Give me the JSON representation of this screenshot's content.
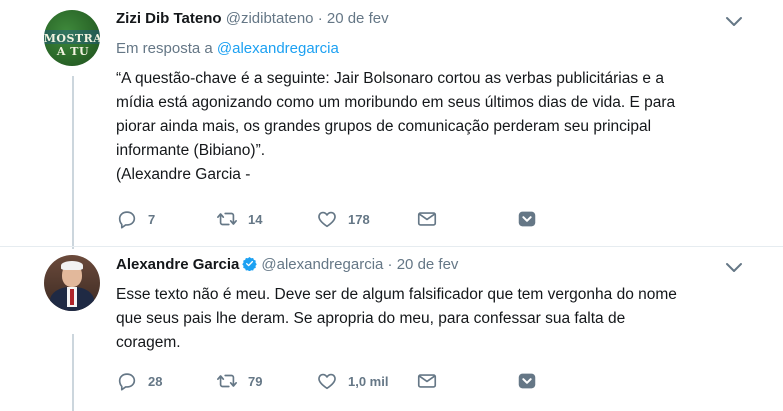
{
  "tweets": [
    {
      "name": "Zizi Dib Tateno",
      "handle": "@zidibtateno",
      "dot": "·",
      "time": "20 de fev",
      "avatar_text": "MOSTRA A TU",
      "reply_prefix": "Em resposta a",
      "reply_to": "@alexandregarcia",
      "text_lines": [
        "“A questão-chave é a seguinte: Jair Bolsonaro cortou as verbas publicitárias e a",
        "mídia está agonizando como um moribundo em seus últimos dias de vida. E para",
        "piorar ainda mais, os grandes grupos de comunicação perderam seu principal",
        "informante (Bibiano)”.",
        "(Alexandre Garcia -"
      ],
      "replies": "7",
      "retweets": "14",
      "likes": "178",
      "verified": false
    },
    {
      "name": "Alexandre Garcia",
      "handle": "@alexandregarcia",
      "dot": "·",
      "time": "20 de fev",
      "text_lines": [
        "Esse texto não é meu. Deve ser de algum falsificador que tem vergonha do nome",
        "que seus pais lhe deram. Se apropria do meu, para confessar sua falta de",
        "coragem."
      ],
      "replies": "28",
      "retweets": "79",
      "likes": "1,0 mil",
      "verified": true
    }
  ],
  "colors": {
    "accent": "#1da1f2",
    "muted": "#657786",
    "text": "#14171a",
    "line": "#ccd6dd"
  },
  "icons": [
    "reply-icon",
    "retweet-icon",
    "like-icon",
    "message-icon",
    "bookmark-icon",
    "caret-down-icon",
    "verified-badge-icon"
  ]
}
